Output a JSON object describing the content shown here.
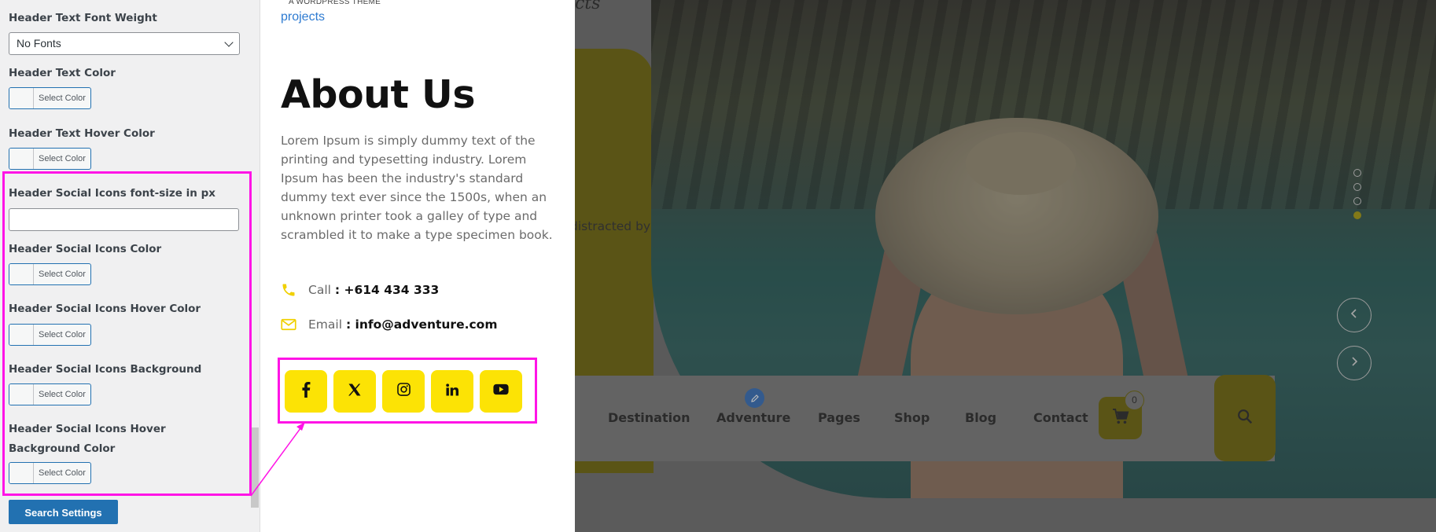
{
  "sidebar": {
    "font_weight_label": "Header Text Font Weight",
    "font_weight_value": "No Fonts",
    "text_color_label": "Header Text Color",
    "text_hover_color_label": "Header Text Hover Color",
    "social_font_size_label": "Header Social Icons font-size in px",
    "social_font_size_value": "",
    "social_color_label": "Header Social Icons Color",
    "social_hover_color_label": "Header Social Icons Hover Color",
    "social_bg_color_label": "Header Social Icons Background Color",
    "social_hover_bg_color_label": "Header Social Icons Hover Background Color",
    "select_color_label": "Select Color",
    "search_settings_label": "Search Settings"
  },
  "about": {
    "wp_tag": "A WORDPRESS THEME",
    "projects_link": "projects",
    "title": "About Us",
    "body": "Lorem Ipsum is simply dummy text of the printing and typesetting industry. Lorem Ipsum has been the industry's standard dummy text ever since the 1500s, when an unknown printer took a galley of type and scrambled it to make a type specimen book.",
    "call_label": "Call",
    "call_value": ": +614 434 333",
    "email_label": "Email",
    "email_value": ": info@adventure.com",
    "social_icons": [
      "facebook-icon",
      "x-icon",
      "instagram-icon",
      "linkedin-icon",
      "youtube-icon"
    ]
  },
  "hero": {
    "cursive_fragment": "cts",
    "distracted_fragment": "distracted by",
    "nav": [
      "Destination",
      "Adventure",
      "Pages",
      "Shop",
      "Blog",
      "Contact"
    ],
    "cart_count": "0",
    "slider_dots": 4,
    "active_dot": 4
  },
  "colors": {
    "accent_yellow": "#fce305",
    "highlight_magenta": "#ff14e6",
    "wp_blue": "#2271b1"
  }
}
